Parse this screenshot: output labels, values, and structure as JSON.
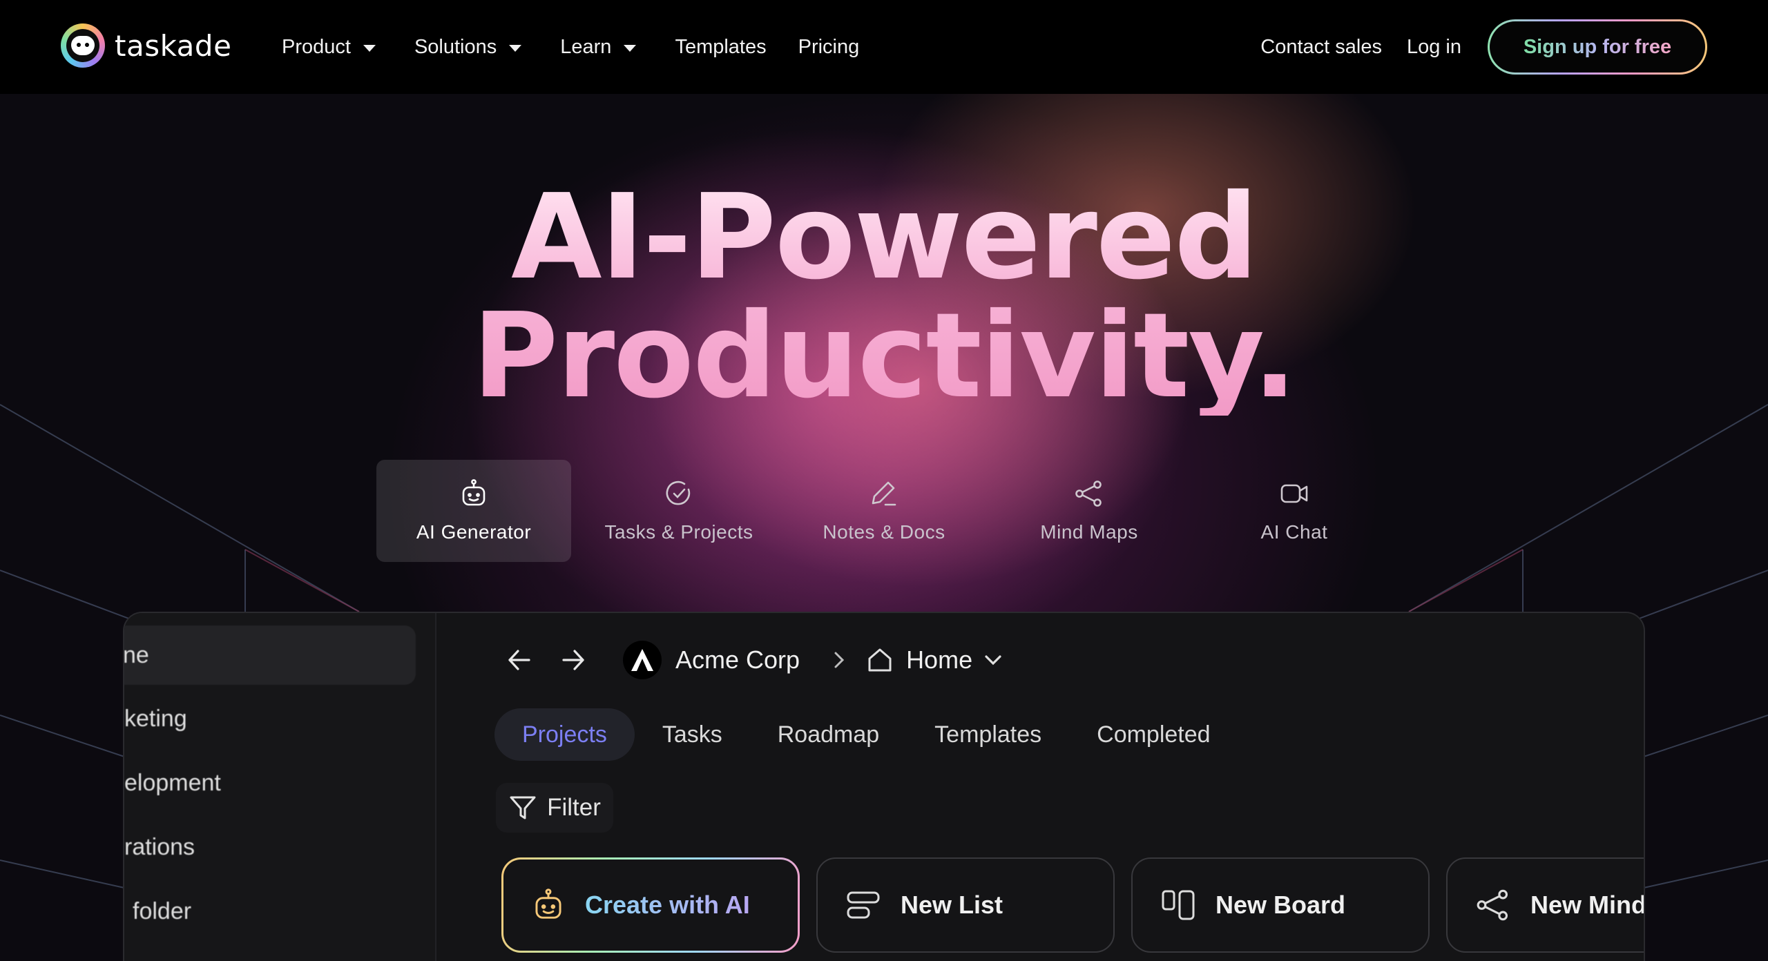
{
  "nav": {
    "logo_text": "taskade",
    "links": [
      {
        "label": "Product",
        "has_caret": true
      },
      {
        "label": "Solutions",
        "has_caret": true
      },
      {
        "label": "Learn",
        "has_caret": true
      },
      {
        "label": "Templates",
        "has_caret": false
      },
      {
        "label": "Pricing",
        "has_caret": false
      }
    ],
    "contact_sales": "Contact sales",
    "log_in": "Log in",
    "sign_up": "Sign up for free"
  },
  "hero": {
    "title_line1": "AI-Powered",
    "title_line2": "Productivity."
  },
  "features": [
    {
      "label": "AI Generator",
      "icon": "robot-icon",
      "active": true
    },
    {
      "label": "Tasks & Projects",
      "icon": "check-circle-icon",
      "active": false
    },
    {
      "label": "Notes & Docs",
      "icon": "pen-icon",
      "active": false
    },
    {
      "label": "Mind Maps",
      "icon": "share-nodes-icon",
      "active": false
    },
    {
      "label": "AI Chat",
      "icon": "video-icon",
      "active": false
    }
  ],
  "app": {
    "sidebar": [
      "ne",
      "keting",
      "elopment",
      "rations",
      "folder"
    ],
    "breadcrumb": {
      "org": "Acme Corp",
      "page": "Home"
    },
    "tabs": [
      "Projects",
      "Tasks",
      "Roadmap",
      "Templates",
      "Completed"
    ],
    "active_tab": "Projects",
    "filter_label": "Filter",
    "actions": [
      {
        "label": "Create with AI",
        "icon": "robot-icon"
      },
      {
        "label": "New List",
        "icon": "list-icon"
      },
      {
        "label": "New Board",
        "icon": "board-icon"
      },
      {
        "label": "New Mind",
        "icon": "share-nodes-icon"
      }
    ]
  },
  "colors": {
    "accent_purple": "#7c7ff3",
    "signup_gradient": [
      "#8fe3b0",
      "#b7a3f7",
      "#f39ac4",
      "#f6c878"
    ],
    "hero_glow": "#be4696"
  }
}
